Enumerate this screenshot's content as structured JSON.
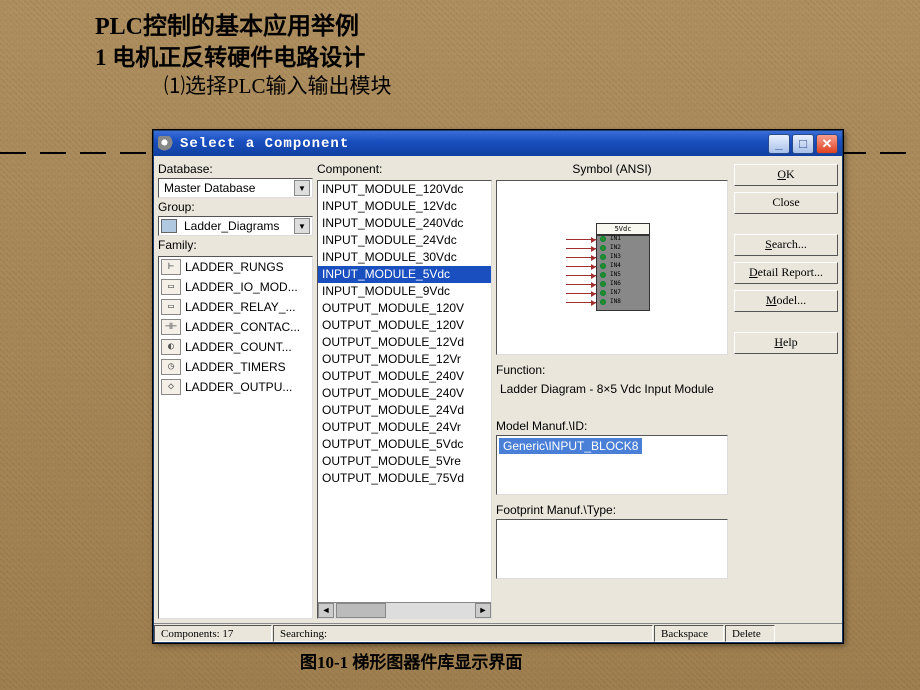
{
  "headings": {
    "h1": "PLC控制的基本应用举例",
    "h2": "1  电机正反转硬件电路设计",
    "h3": "⑴选择PLC输入输出模块",
    "caption": "图10-1 梯形图器件库显示界面"
  },
  "window": {
    "title": "Select a Component",
    "labels": {
      "database": "Database:",
      "group": "Group:",
      "family": "Family:",
      "component": "Component:",
      "symbol": "Symbol (ANSI)",
      "function": "Function:",
      "model": "Model Manuf.\\ID:",
      "footprint": "Footprint Manuf.\\Type:"
    },
    "database_value": "Master Database",
    "group_value": "Ladder_Diagrams",
    "families": [
      {
        "icon": "⊢",
        "label": "LADDER_RUNGS"
      },
      {
        "icon": "▭",
        "label": "LADDER_IO_MOD..."
      },
      {
        "icon": "▭",
        "label": "LADDER_RELAY_..."
      },
      {
        "icon": "⊣⊢",
        "label": "LADDER_CONTAC..."
      },
      {
        "icon": "◐",
        "label": "LADDER_COUNT..."
      },
      {
        "icon": "◷",
        "label": "LADDER_TIMERS"
      },
      {
        "icon": "◇",
        "label": "LADDER_OUTPU..."
      }
    ],
    "components": [
      "INPUT_MODULE_120Vdc",
      "INPUT_MODULE_12Vdc",
      "INPUT_MODULE_240Vdc",
      "INPUT_MODULE_24Vdc",
      "INPUT_MODULE_30Vdc",
      "INPUT_MODULE_5Vdc",
      "INPUT_MODULE_9Vdc",
      "OUTPUT_MODULE_120V",
      "OUTPUT_MODULE_120V",
      "OUTPUT_MODULE_12Vd",
      "OUTPUT_MODULE_12Vr",
      "OUTPUT_MODULE_240V",
      "OUTPUT_MODULE_240V",
      "OUTPUT_MODULE_24Vd",
      "OUTPUT_MODULE_24Vr",
      "OUTPUT_MODULE_5Vdc",
      "OUTPUT_MODULE_5Vre",
      "OUTPUT_MODULE_75Vd"
    ],
    "selected_index": 5,
    "symbol_head": "5Vdc",
    "pin_labels": [
      "IN1",
      "IN2",
      "IN3",
      "IN4",
      "IN5",
      "IN6",
      "IN7",
      "IN8"
    ],
    "function_text": "Ladder Diagram - 8×5 Vdc Input Module",
    "model_value": "Generic\\INPUT_BLOCK8",
    "buttons": {
      "ok": "OK",
      "close": "Close",
      "search": "Search...",
      "detail": "Detail Report...",
      "model": "Model...",
      "help": "Help"
    },
    "status": {
      "components": "Components: 17",
      "searching": "Searching:",
      "backspace": "Backspace",
      "delete": "Delete"
    }
  }
}
